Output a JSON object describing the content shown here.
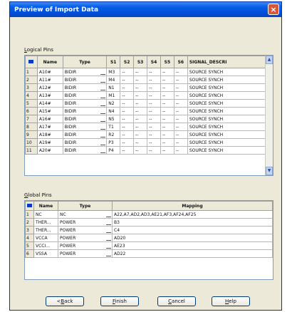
{
  "window": {
    "title": "Preview of Import Data",
    "close_glyph": "×"
  },
  "logical": {
    "label": "Logical Pins",
    "label_underline": "L",
    "label_rest": "ogical Pins",
    "columns": [
      "Name",
      "Type",
      "S1",
      "S2",
      "S3",
      "S4",
      "S5",
      "S6",
      "SIGNAL_DESCRI"
    ],
    "rows": [
      {
        "num": "1",
        "name": "A10#",
        "type": "BIDIR",
        "s1": "M3",
        "s2": "--",
        "s3": "--",
        "s4": "--",
        "s5": "--",
        "s6": "--",
        "desc": "SOURCE SYNCH"
      },
      {
        "num": "2",
        "name": "A11#",
        "type": "BIDIR",
        "s1": "M4",
        "s2": "--",
        "s3": "--",
        "s4": "--",
        "s5": "--",
        "s6": "--",
        "desc": "SOURCE SYNCH"
      },
      {
        "num": "3",
        "name": "A12#",
        "type": "BIDIR",
        "s1": "N1",
        "s2": "--",
        "s3": "--",
        "s4": "--",
        "s5": "--",
        "s6": "--",
        "desc": "SOURCE SYNCH"
      },
      {
        "num": "4",
        "name": "A13#",
        "type": "BIDIR",
        "s1": "M1",
        "s2": "--",
        "s3": "--",
        "s4": "--",
        "s5": "--",
        "s6": "--",
        "desc": "SOURCE SYNCH"
      },
      {
        "num": "5",
        "name": "A14#",
        "type": "BIDIR",
        "s1": "N2",
        "s2": "--",
        "s3": "--",
        "s4": "--",
        "s5": "--",
        "s6": "--",
        "desc": "SOURCE SYNCH"
      },
      {
        "num": "6",
        "name": "A15#",
        "type": "BIDIR",
        "s1": "N4",
        "s2": "--",
        "s3": "--",
        "s4": "--",
        "s5": "--",
        "s6": "--",
        "desc": "SOURCE SYNCH"
      },
      {
        "num": "7",
        "name": "A16#",
        "type": "BIDIR",
        "s1": "N5",
        "s2": "--",
        "s3": "--",
        "s4": "--",
        "s5": "--",
        "s6": "--",
        "desc": "SOURCE SYNCH"
      },
      {
        "num": "8",
        "name": "A17#",
        "type": "BIDIR",
        "s1": "T1",
        "s2": "--",
        "s3": "--",
        "s4": "--",
        "s5": "--",
        "s6": "--",
        "desc": "SOURCE SYNCH"
      },
      {
        "num": "9",
        "name": "A18#",
        "type": "BIDIR",
        "s1": "R2",
        "s2": "--",
        "s3": "--",
        "s4": "--",
        "s5": "--",
        "s6": "--",
        "desc": "SOURCE SYNCH"
      },
      {
        "num": "10",
        "name": "A19#",
        "type": "BIDIR",
        "s1": "P3",
        "s2": "--",
        "s3": "--",
        "s4": "--",
        "s5": "--",
        "s6": "--",
        "desc": "SOURCE SYNCH"
      },
      {
        "num": "11",
        "name": "A20#",
        "type": "BIDIR",
        "s1": "P4",
        "s2": "--",
        "s3": "--",
        "s4": "--",
        "s5": "--",
        "s6": "--",
        "desc": "SOURCE SYNCH"
      }
    ]
  },
  "global": {
    "label": "Global Pins",
    "label_underline": "G",
    "label_rest": "lobal Pins",
    "columns": [
      "Name",
      "Type",
      "Mapping"
    ],
    "rows": [
      {
        "num": "1",
        "name": "NC",
        "type": "NC",
        "mapping": "A22,A7,AD2,AD3,AE21,AF3,AF24,AF25"
      },
      {
        "num": "2",
        "name": "THER...",
        "type": "POWER",
        "mapping": "B3"
      },
      {
        "num": "3",
        "name": "THER...",
        "type": "POWER",
        "mapping": "C4"
      },
      {
        "num": "4",
        "name": "VCCA",
        "type": "POWER",
        "mapping": "AD20"
      },
      {
        "num": "5",
        "name": "VCCI...",
        "type": "POWER",
        "mapping": "AE23"
      },
      {
        "num": "6",
        "name": "VSSA",
        "type": "POWER",
        "mapping": "AD22"
      }
    ]
  },
  "buttons": {
    "back_u": "B",
    "back_pre": "<",
    "back_post": "ack",
    "finish_u": "F",
    "finish_post": "inish",
    "cancel_u": "C",
    "cancel_post": "ancel",
    "help_u": "H",
    "help_post": "elp"
  },
  "icons": {
    "corner": "grid-select-all-icon",
    "scroll_up": "scroll-up-arrow-icon",
    "scroll_down": "scroll-down-arrow-icon",
    "dropdown": "dropdown-icon"
  },
  "colors": {
    "titlebar": "#0a5ee8",
    "dialog_bg": "#ece9d8",
    "close": "#d8563a"
  }
}
